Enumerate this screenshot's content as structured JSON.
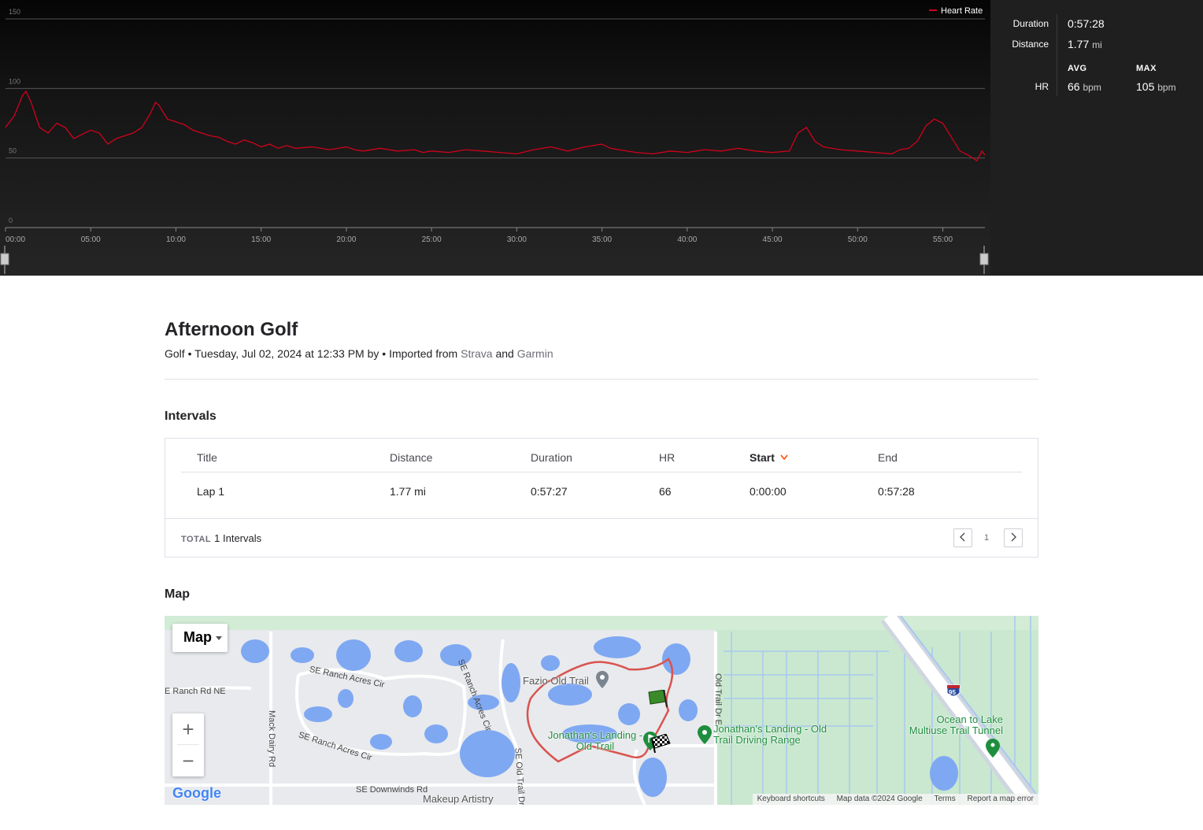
{
  "chart": {
    "legend_label": "Heart Rate",
    "line_color": "#d0021b",
    "y_ticks": [
      "150",
      "100",
      "50",
      "0"
    ],
    "x_ticks": [
      "00:00",
      "05:00",
      "10:00",
      "15:00",
      "20:00",
      "25:00",
      "30:00",
      "35:00",
      "40:00",
      "45:00",
      "50:00",
      "55:00"
    ]
  },
  "chart_data": {
    "type": "line",
    "title": "",
    "xlabel": "",
    "ylabel": "",
    "ylim": [
      0,
      150
    ],
    "xlim": [
      0,
      57.47
    ],
    "grid": true,
    "legend": "top-right",
    "series": [
      {
        "name": "Heart Rate",
        "color": "#d0021b",
        "x": [
          0,
          0.5,
          1,
          1.2,
          1.5,
          2,
          2.5,
          3,
          3.5,
          4,
          4.5,
          5,
          5.5,
          6,
          6.5,
          7,
          7.5,
          8,
          8.5,
          8.8,
          9,
          9.5,
          10,
          10.5,
          11,
          11.5,
          12,
          12.5,
          13,
          13.5,
          14,
          14.5,
          15,
          15.5,
          16,
          16.5,
          17,
          18,
          19,
          20,
          20.5,
          21,
          22,
          23,
          24,
          24.5,
          25,
          26,
          27,
          28,
          29,
          30,
          31,
          32,
          33,
          34,
          35,
          35.5,
          36,
          37,
          38,
          39,
          40,
          41,
          42,
          43,
          44,
          45,
          46,
          46.5,
          47,
          47.5,
          48,
          49,
          50,
          51,
          52,
          52.5,
          53,
          53.5,
          54,
          54.5,
          55,
          55.5,
          56,
          56.5,
          57,
          57.3,
          57.47
        ],
        "values": [
          72,
          80,
          95,
          98,
          90,
          72,
          68,
          75,
          72,
          64,
          67,
          70,
          68,
          60,
          64,
          66,
          68,
          72,
          82,
          90,
          88,
          78,
          76,
          74,
          70,
          68,
          66,
          65,
          62,
          60,
          63,
          61,
          58,
          60,
          57,
          59,
          57,
          58,
          56,
          58,
          56,
          55,
          57,
          55,
          56,
          54,
          55,
          54,
          56,
          55,
          54,
          53,
          56,
          58,
          55,
          58,
          60,
          57,
          56,
          54,
          53,
          55,
          54,
          56,
          55,
          57,
          55,
          54,
          55,
          68,
          72,
          62,
          58,
          56,
          55,
          54,
          53,
          56,
          57,
          62,
          73,
          78,
          75,
          65,
          55,
          52,
          48,
          55,
          52
        ]
      }
    ]
  },
  "stats": {
    "duration_label": "Duration",
    "duration_value": "0:57:28",
    "distance_label": "Distance",
    "distance_value": "1.77",
    "distance_unit": "mi",
    "avg_header": "AVG",
    "max_header": "MAX",
    "hr_label": "HR",
    "hr_avg": "66",
    "hr_max": "105",
    "hr_unit": "bpm"
  },
  "activity": {
    "title": "Afternoon Golf",
    "sport": "Golf",
    "sep1": " • ",
    "date_text": "Tuesday, Jul 02, 2024 at 12:33 PM by",
    "sep2": " • ",
    "imported_from": "Imported from ",
    "source1": "Strava",
    "and": " and ",
    "source2": "Garmin"
  },
  "intervals": {
    "heading": "Intervals",
    "columns": [
      "Title",
      "Distance",
      "Duration",
      "HR",
      "Start",
      "End"
    ],
    "sort_icon": "chevron-down-icon",
    "rows": [
      {
        "title": "Lap 1",
        "distance": "1.77 mi",
        "duration": "0:57:27",
        "hr": "66",
        "start": "0:00:00",
        "end": "0:57:28"
      }
    ],
    "total_label": "TOTAL",
    "total_value": "1 Intervals",
    "page": "1"
  },
  "map": {
    "heading": "Map",
    "type_button": "Map",
    "zoom_in": "+",
    "zoom_out": "−",
    "logo": "Google",
    "labels": [
      "E Ranch Rd NE",
      "SE Ranch Acres Cir",
      "SE Ranch Acres Cir",
      "SE Ranch Acres Cir",
      "Mack Dairy Rd",
      "SE Downwinds Rd",
      "SE Old Trail Dr W",
      "Old Trail Dr E"
    ],
    "pois": [
      "Fazio Old Trail",
      "Jonathan's Landing - Old Trail",
      "Jonathan's Landing - Old Trail Driving Range",
      "Ocean to Lake Multiuse Trail Tunnel",
      "Makeup Artistry"
    ],
    "highway": "95",
    "attribution": [
      "Keyboard shortcuts",
      "Map data ©2024 Google",
      "Terms",
      "Report a map error"
    ],
    "route_color": "#d9534f"
  }
}
